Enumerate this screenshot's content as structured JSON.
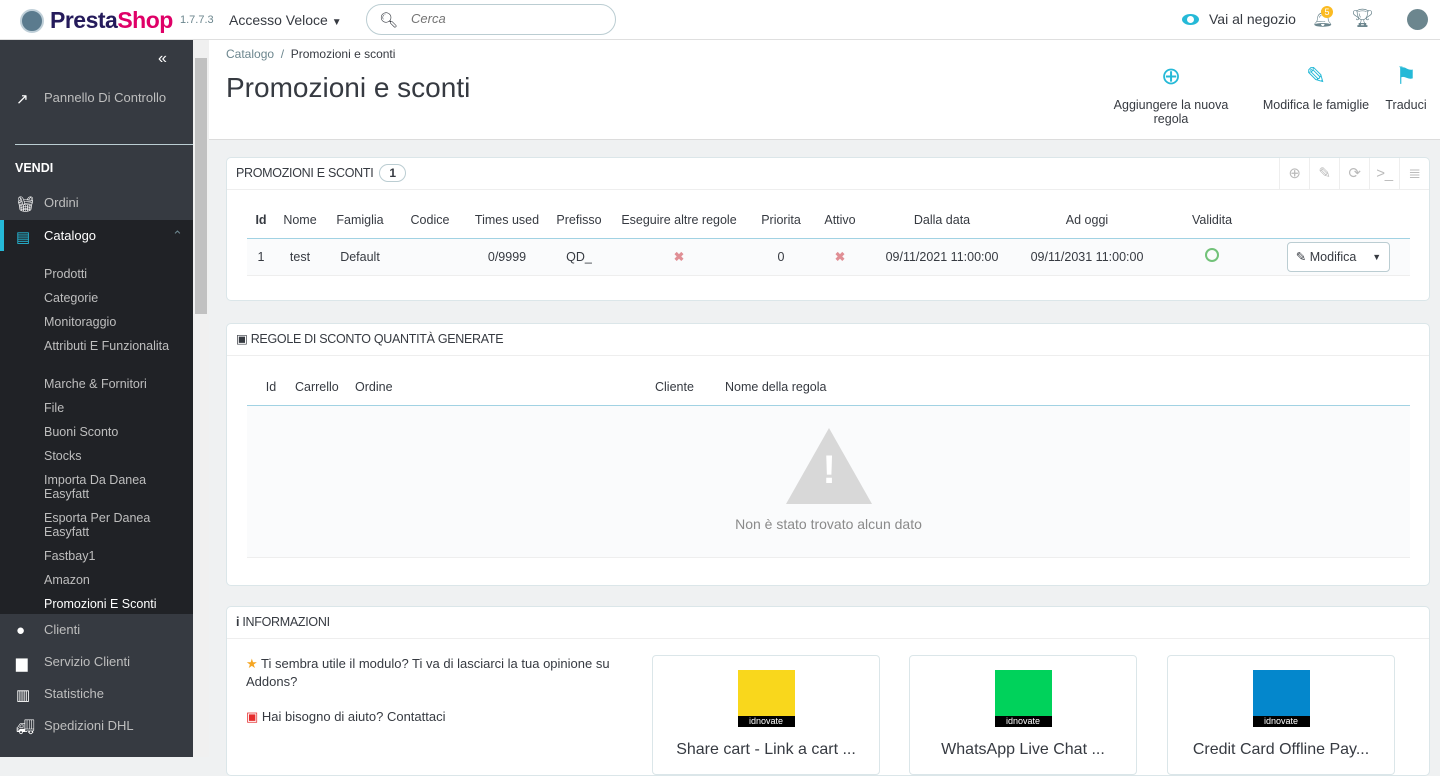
{
  "topbar": {
    "logo_p": "Presta",
    "logo_s": "Shop",
    "version": "1.7.7.3",
    "quick_access": "Accesso Veloce",
    "search_placeholder": "Cerca",
    "view_shop": "Vai al negozio",
    "notifications": "5"
  },
  "sidebar": {
    "dashboard": "Pannello Di Controllo",
    "section": "VENDI",
    "orders": "Ordini",
    "catalog": "Catalogo",
    "catalog_sub": [
      "Prodotti",
      "Categorie",
      "Monitoraggio",
      "Attributi E Funzionalita",
      "Marche & Fornitori",
      "File",
      "Buoni Sconto",
      "Stocks",
      "Importa Da Danea Easyfatt",
      "Esporta Per Danea Easyfatt",
      "Fastbay1",
      "Amazon",
      "Promozioni E Sconti"
    ],
    "customers": "Clienti",
    "service": "Servizio Clienti",
    "stats": "Statistiche",
    "dhl": "Spedizioni DHL"
  },
  "header": {
    "breadcrumb_parent": "Catalogo",
    "breadcrumb_current": "Promozioni e sconti",
    "title": "Promozioni e sconti",
    "add_rule": "Aggiungere la nuova regola",
    "edit_families": "Modifica le famiglie",
    "translate": "Traduci"
  },
  "rules": {
    "title": "PROMOZIONI E SCONTI",
    "count": "1",
    "columns": [
      "Id",
      "Nome",
      "Famiglia",
      "Codice",
      "Times used",
      "Prefisso",
      "Eseguire altre regole",
      "Priorita",
      "Attivo",
      "Dalla data",
      "Ad oggi",
      "Validita",
      ""
    ],
    "rows": [
      {
        "id": "1",
        "name": "test",
        "family": "Default",
        "code": "",
        "times_used": "0/9999",
        "prefix": "QD_",
        "other_rules": "✖",
        "priority": "0",
        "active": "✖",
        "from": "09/11/2021 11:00:00",
        "to": "09/11/2031 11:00:00",
        "edit": "Modifica"
      }
    ]
  },
  "generated": {
    "title": "REGOLE DI SCONTO QUANTITÀ GENERATE",
    "columns": [
      "Id",
      "Carrello",
      "Ordine",
      "Cliente",
      "Nome della regola"
    ],
    "empty": "Non è stato trovato alcun dato"
  },
  "info": {
    "title": "INFORMAZIONI",
    "review": "Ti sembra utile il modulo? Ti va di lasciarci la tua opinione su Addons?",
    "help": "Hai bisogno di aiuto? Contattaci",
    "modules": [
      {
        "name": "Share cart - Link a cart ...",
        "brand": "idnovate",
        "color": "#f9d71c"
      },
      {
        "name": "WhatsApp Live Chat ...",
        "brand": "idnovate",
        "color": "#00d25b"
      },
      {
        "name": "Credit Card Offline Pay...",
        "brand": "idnovate",
        "color": "#0487cc"
      }
    ]
  }
}
